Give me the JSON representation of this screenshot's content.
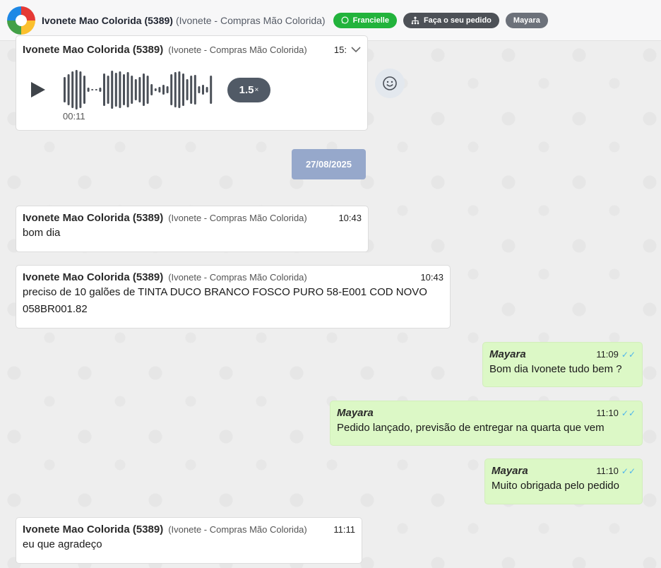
{
  "header": {
    "title": "Ivonete Mao Colorida (5389)",
    "subtitle": "(Ivonete - Compras Mão Colorida)",
    "pills": {
      "whatsapp": "Francielle",
      "order": "Faça o seu pedido",
      "agent": "Mayara"
    }
  },
  "audio_message": {
    "sender": "Ivonete Mao Colorida (5389)",
    "group": "(Ivonete - Compras Mão Colorida)",
    "time": "15:",
    "duration": "00:11",
    "speed_value": "1.5",
    "speed_suffix": "×"
  },
  "date_separator": "27/08/2025",
  "messages": [
    {
      "direction": "in",
      "sender": "Ivonete Mao Colorida (5389)",
      "group": "(Ivonete - Compras Mão Colorida)",
      "time": "10:43",
      "text": "bom dia"
    },
    {
      "direction": "in",
      "sender": "Ivonete Mao Colorida (5389)",
      "group": "(Ivonete - Compras Mão Colorida)",
      "time": "10:43",
      "text": "preciso de 10 galões de TINTA DUCO BRANCO FOSCO PURO 58-E001 COD NOVO 058BR001.82"
    },
    {
      "direction": "out",
      "sender": "Mayara",
      "time": "11:09",
      "text": "Bom dia Ivonete tudo bem ?"
    },
    {
      "direction": "out",
      "sender": "Mayara",
      "time": "11:10",
      "text": "Pedido lançado, previsão de entregar na quarta que vem"
    },
    {
      "direction": "out",
      "sender": "Mayara",
      "time": "11:10",
      "text": "Muito obrigada pelo pedido"
    },
    {
      "direction": "in",
      "sender": "Ivonete Mao Colorida (5389)",
      "group": "(Ivonete - Compras Mão Colorida)",
      "time": "11:11",
      "text": "eu que agradeço"
    }
  ],
  "colors": {
    "whatsapp_green": "#22b33c",
    "outgoing_bubble": "#dcf8c6",
    "read_ticks": "#4fb6ec",
    "date_chip": "#96a8cb"
  },
  "icons": {
    "logo": "brand-hand-logo",
    "whatsapp": "whatsapp-icon",
    "order": "hierarchy-icon",
    "emoji": "smiley-icon",
    "play": "play-icon",
    "chevron": "chevron-down-icon",
    "ticks": "double-check-icon"
  }
}
